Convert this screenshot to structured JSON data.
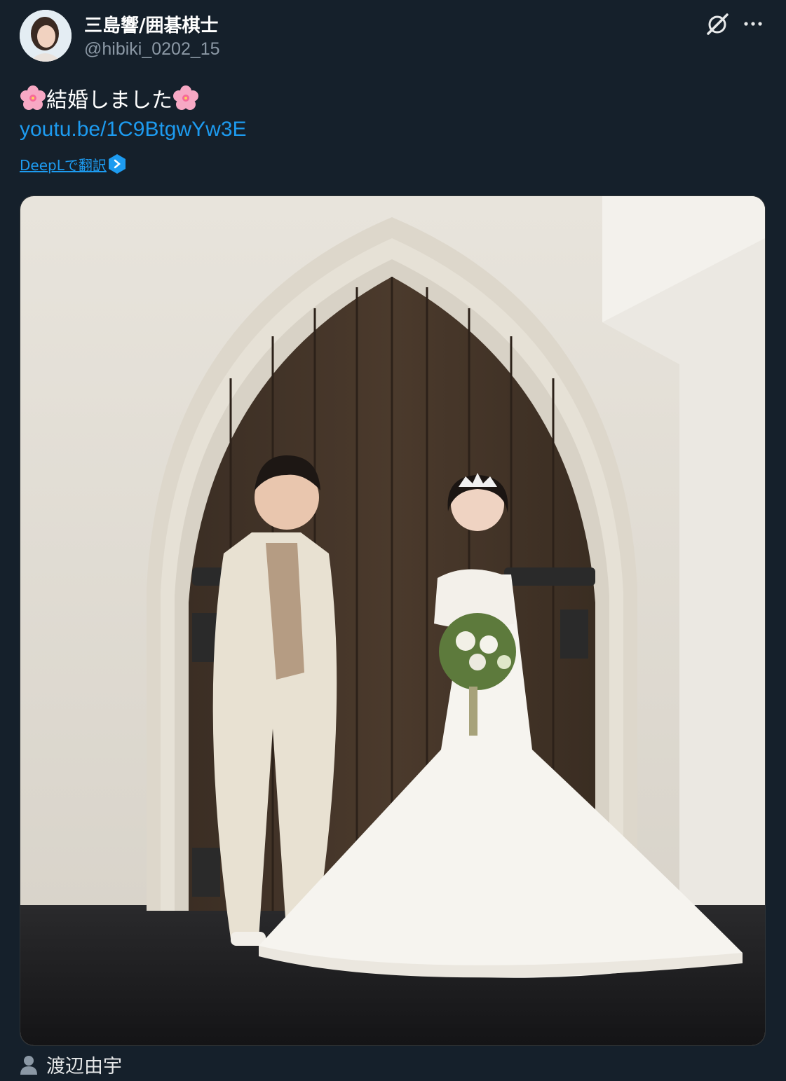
{
  "colors": {
    "background": "#15202b",
    "link": "#1d9bf0",
    "secondary_text": "#8b98a5",
    "primary_text": "#ffffff"
  },
  "tweet": {
    "author_name": "三島響/囲碁棋士",
    "author_handle": "@hibiki_0202_15",
    "text_emoji_left": "cherry-blossom-emoji",
    "text": "結婚しました",
    "text_emoji_right": "cherry-blossom-emoji",
    "link": "youtu.be/1C9BtgwYw3E",
    "translate_label": "DeepLで翻訳",
    "tagged_user": "渡辺由宇"
  },
  "icons": {
    "grok": "grok-icon",
    "more": "more-icon",
    "deepl": "deepl-icon",
    "person": "person-icon"
  }
}
